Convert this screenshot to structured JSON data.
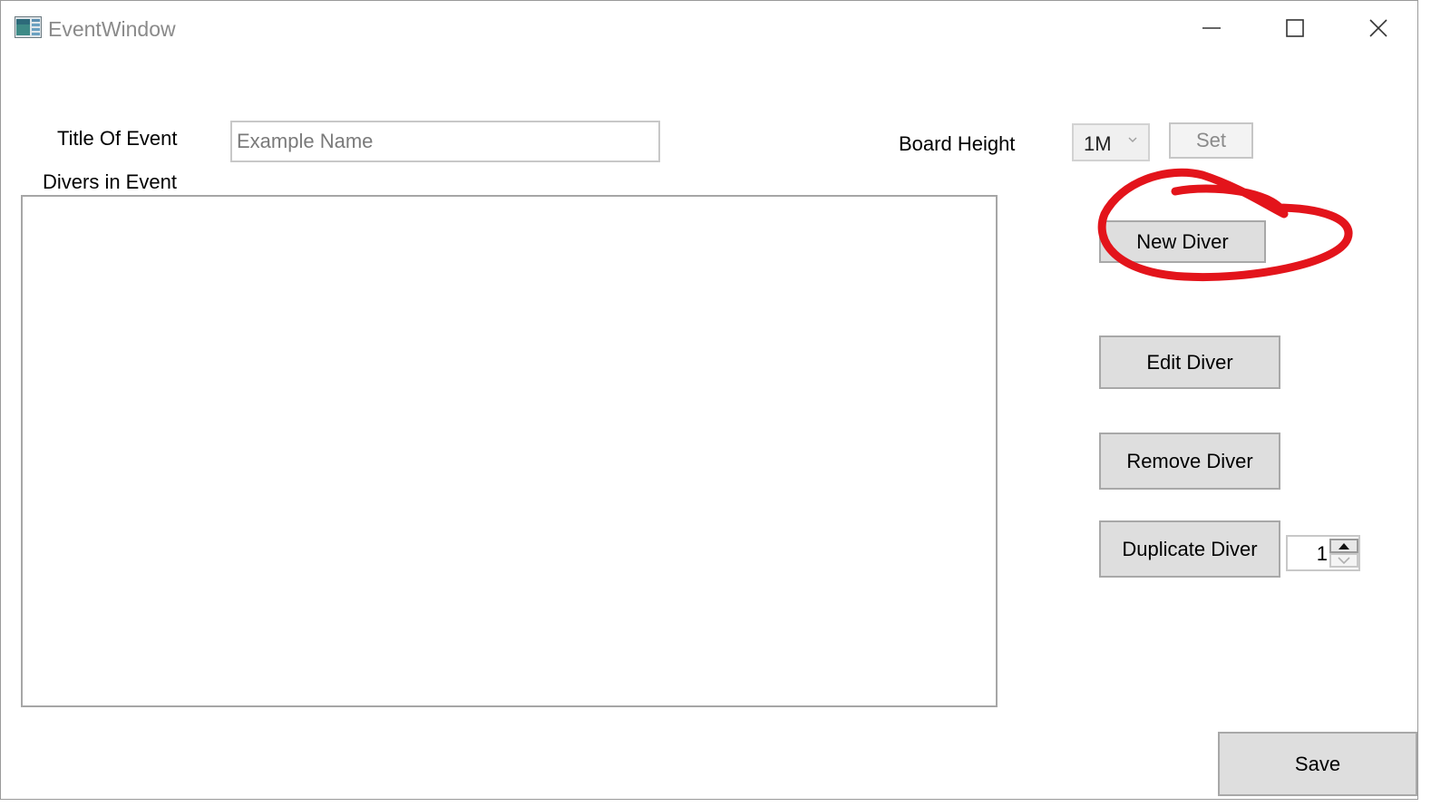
{
  "window": {
    "title": "EventWindow"
  },
  "form": {
    "title_label": "Title Of Event",
    "title_placeholder": "Example Name",
    "title_value": "",
    "divers_label": "Divers in Event",
    "board_height_label": "Board Height",
    "board_height_value": "1M",
    "set_label": "Set"
  },
  "actions": {
    "new_diver": "New Diver",
    "edit_diver": "Edit Diver",
    "remove_diver": "Remove Diver",
    "duplicate_diver": "Duplicate Diver",
    "duplicate_count": "1",
    "save": "Save"
  },
  "icons": {
    "app": "app-window-icon",
    "minimize": "minimize-icon",
    "maximize": "maximize-icon",
    "close": "close-icon",
    "dropdown": "chevron-down-icon",
    "step_up": "triangle-up-icon",
    "step_down": "chevron-down-icon"
  },
  "annotation": {
    "color": "#e3141b",
    "target": "New Diver"
  }
}
